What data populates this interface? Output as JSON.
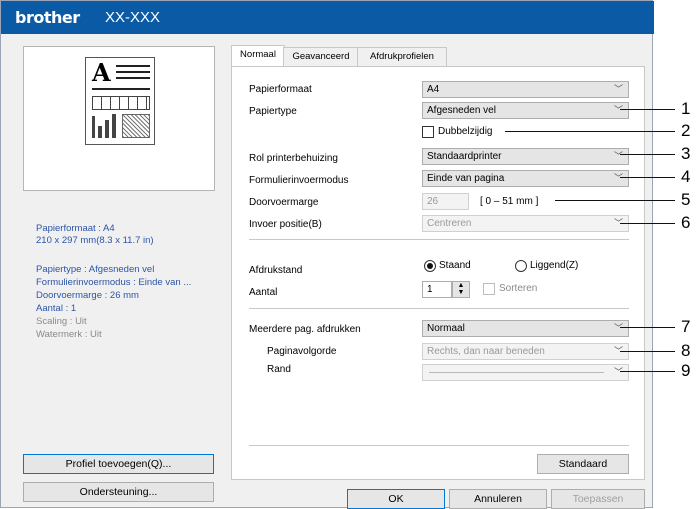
{
  "window": {
    "brand": "brother",
    "model": "XX-XXX"
  },
  "left_panel": {
    "info_paper": "Papierformaat : A4",
    "info_size": "210 x 297 mm(8.3 x 11.7 in)",
    "info_lines": [
      "Papiertype : Afgesneden vel",
      "Formulierinvoermodus : Einde van ...",
      "Doorvoermarge : 26 mm",
      "Aantal : 1"
    ],
    "info_lines_grey": [
      "Scaling : Uit",
      "Watermerk : Uit"
    ],
    "profile_button": "Profiel toevoegen(Q)...",
    "support_button": "Ondersteuning..."
  },
  "tabs": [
    "Normaal",
    "Geavanceerd",
    "Afdrukprofielen"
  ],
  "settings": {
    "papierformaat": {
      "label": "Papierformaat",
      "value": "A4"
    },
    "papiertype": {
      "label": "Papiertype",
      "value": "Afgesneden vel"
    },
    "dubbelzijdig": {
      "label": "Dubbelzijdig",
      "checked": false
    },
    "rol": {
      "label": "Rol printerbehuizing",
      "value": "Standaardprinter"
    },
    "formulier": {
      "label": "Formulierinvoermodus",
      "value": "Einde van pagina"
    },
    "doorvoermarge": {
      "label": "Doorvoermarge",
      "value": "26",
      "range": "[ 0 – 51 mm ]"
    },
    "invoer": {
      "label": "Invoer positie(B)",
      "value": "Centreren"
    },
    "afdrukstand": {
      "label": "Afdrukstand",
      "option1": "Staand",
      "option2": "Liggend(Z)",
      "selected": "Staand"
    },
    "aantal": {
      "label": "Aantal",
      "value": "1",
      "sorteren": "Sorteren"
    },
    "meerdere": {
      "label": "Meerdere pag. afdrukken",
      "value": "Normaal"
    },
    "paginavolgorde": {
      "label": "Paginavolgorde",
      "value": "Rechts, dan naar beneden"
    },
    "rand": {
      "label": "Rand",
      "value": ""
    }
  },
  "standaard_button": "Standaard",
  "footer": {
    "ok": "OK",
    "cancel": "Annuleren",
    "apply": "Toepassen"
  },
  "callouts": [
    "1",
    "2",
    "3",
    "4",
    "5",
    "6",
    "7",
    "8",
    "9"
  ]
}
